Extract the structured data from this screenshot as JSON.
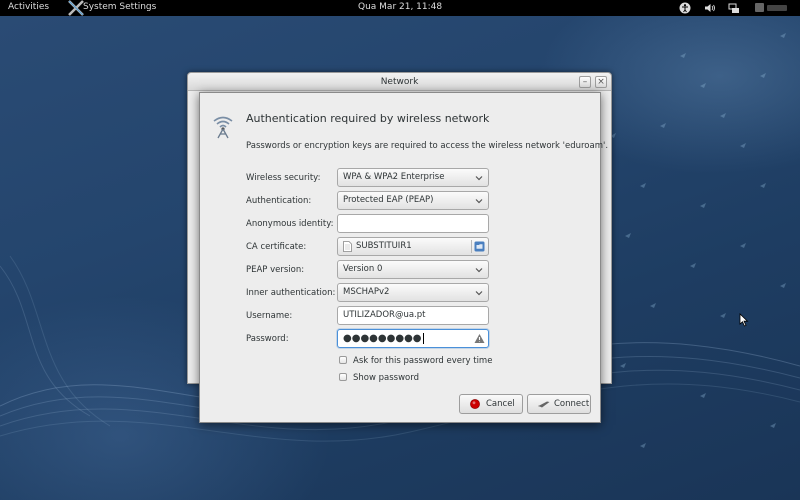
{
  "topbar": {
    "activities": "Activities",
    "app_name": "System Settings",
    "clock": "Qua Mar 21, 11:48",
    "icons": [
      "accessibility-icon",
      "volume-icon",
      "network-icon",
      "user-menu-icon"
    ]
  },
  "background_window": {
    "title": "Network",
    "minimize_label": "–",
    "close_label": "×"
  },
  "dialog": {
    "title": "Authentication required by wireless network",
    "description": "Passwords or encryption keys are required to access the wireless network 'eduroam'.",
    "fields": {
      "wireless_security": {
        "label": "Wireless security:",
        "value": "WPA & WPA2 Enterprise"
      },
      "authentication": {
        "label": "Authentication:",
        "value": "Protected EAP (PEAP)"
      },
      "anonymous_identity": {
        "label": "Anonymous identity:",
        "value": ""
      },
      "ca_certificate": {
        "label": "CA certificate:",
        "value": "SUBSTITUIR1"
      },
      "peap_version": {
        "label": "PEAP version:",
        "value": "Version 0"
      },
      "inner_authentication": {
        "label": "Inner authentication:",
        "value": "MSCHAPv2"
      },
      "username": {
        "label": "Username:",
        "value": "UTILIZADOR@ua.pt"
      },
      "password": {
        "label": "Password:",
        "value": "●●●●●●●●●"
      }
    },
    "checkboxes": {
      "ask_every_time": {
        "label": "Ask for this password every time",
        "checked": false
      },
      "show_password": {
        "label": "Show password",
        "checked": false
      }
    },
    "buttons": {
      "cancel": "Cancel",
      "connect": "Connect"
    }
  },
  "colors": {
    "desktop": "#24456d",
    "topbar": "#000000",
    "dialog_bg": "#ededed",
    "focus": "#4a90d9",
    "cancel_icon": "#cc0000"
  }
}
